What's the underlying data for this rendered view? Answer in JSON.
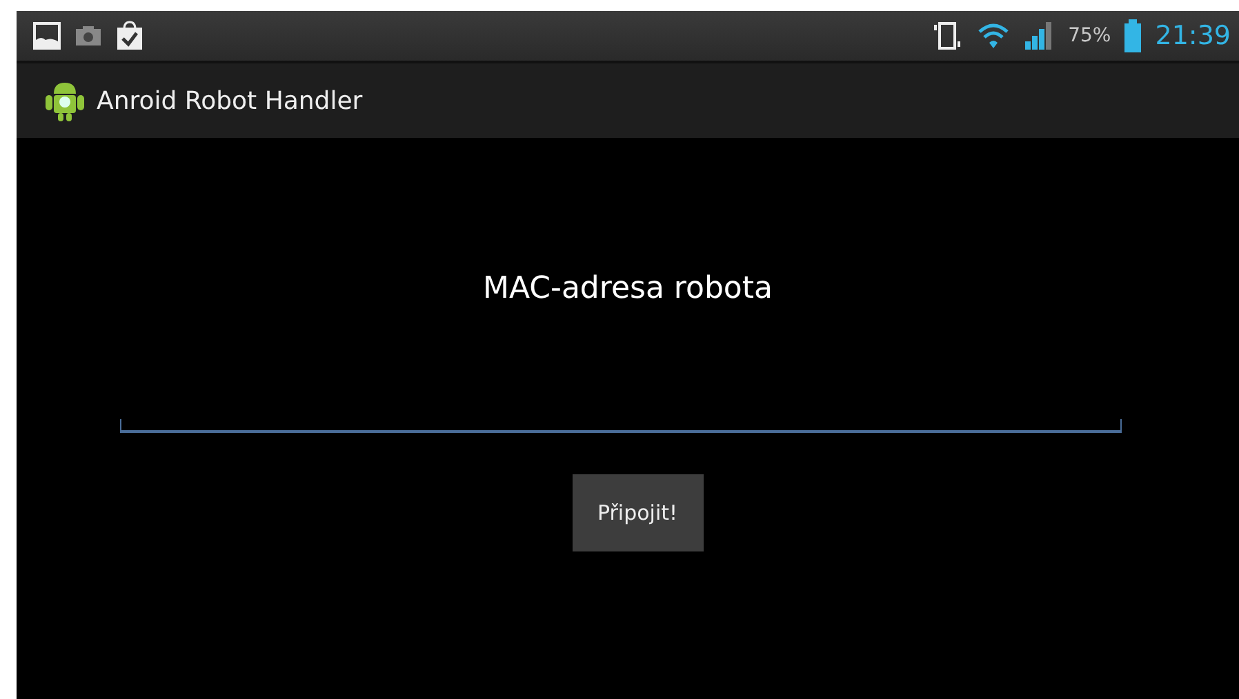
{
  "status_bar": {
    "battery_text": "75%",
    "time": "21:39"
  },
  "action_bar": {
    "title": "Anroid Robot Handler"
  },
  "content": {
    "label": "MAC-adresa robota",
    "button": "Připojit!"
  }
}
